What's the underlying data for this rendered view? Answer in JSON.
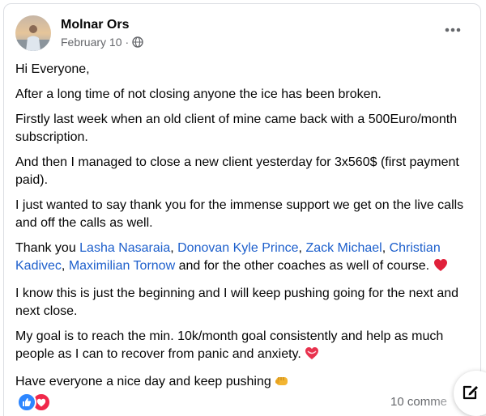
{
  "post": {
    "author": "Molnar Ors",
    "date": "February 10",
    "separator": "·",
    "audience_icon": "globe-icon",
    "menu_icon": "more-horizontal-icon",
    "paragraphs": {
      "p1": "Hi Everyone,",
      "p2": "After a long time of not closing anyone the ice has been broken.",
      "p3": "Firstly last week when an old client of mine came back with a 500Euro/month subscription.",
      "p4": "And then I managed to close a new client yesterday for 3x560$ (first payment paid).",
      "p5": "I just wanted to say thank you for the immense support we get on the live calls and off the calls as well.",
      "p6": {
        "prefix": "Thank you ",
        "mentions": [
          "Lasha Nasaraia",
          "Donovan Kyle Prince",
          "Zack Michael",
          "Christian Kadivec",
          "Maximilian Tornow"
        ],
        "comma": ", ",
        "suffix": " and for the other coaches as well of course. "
      },
      "p7": "I know this is just the beginning and I will keep pushing going for the next and next close.",
      "p8": "My goal is to reach the min. 10k/month goal consistently and help as much people as I can to recover from panic and anxiety. ",
      "p9": "Have everyone a nice day and keep pushing "
    },
    "emojis": [
      "heart-emoji",
      "heart-ribbon-emoji",
      "fist-emoji"
    ],
    "footer": {
      "reaction_icons": [
        "like-icon",
        "love-icon"
      ],
      "comments_count": "10 comme"
    }
  },
  "fab": {
    "icon": "compose-icon"
  },
  "colors": {
    "mention": "#1d5fcc",
    "meta_text": "#65676b",
    "like": "#2d86ff",
    "love": "#f0284a"
  }
}
